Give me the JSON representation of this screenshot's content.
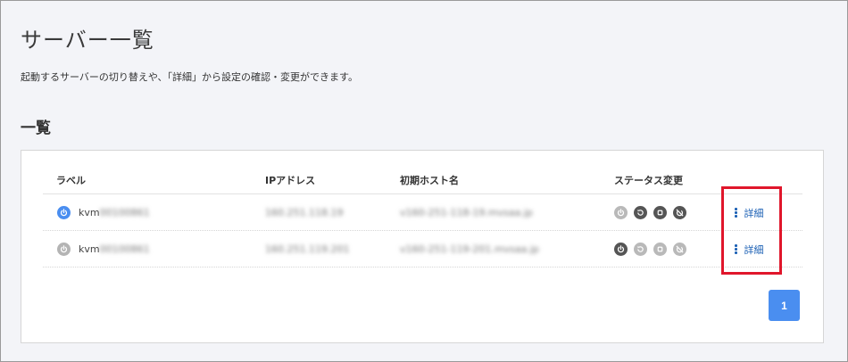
{
  "page": {
    "title": "サーバー一覧",
    "description": "起動するサーバーの切り替えや、「詳細」から設定の確認・変更ができます。",
    "section_title": "一覧"
  },
  "table": {
    "headers": {
      "label": "ラベル",
      "ip": "IPアドレス",
      "hostname": "初期ホスト名",
      "status": "ステータス変更"
    },
    "rows": [
      {
        "label_prefix": "kvm",
        "label_suffix": "00100861",
        "ip": "160.251.118.19",
        "hostname": "v160-251-118-19.mvsaa.jp",
        "power_state": "on",
        "detail_label": "詳細"
      },
      {
        "label_prefix": "kvm",
        "label_suffix": "00100861",
        "ip": "160.251.119.201",
        "hostname": "v160-251-119-201.mvsaa.jp",
        "power_state": "off",
        "detail_label": "詳細"
      }
    ]
  },
  "pagination": {
    "current": "1"
  },
  "colors": {
    "power_on": "#4a8ef0",
    "power_off": "#b4b4b4",
    "icon_active": "#555555",
    "icon_disabled": "#b9b9b9",
    "link": "#1a5fb4",
    "highlight": "#e0162b"
  },
  "icons": [
    "power-icon",
    "restart-icon",
    "stop-icon",
    "force-stop-icon",
    "kebab-icon"
  ]
}
